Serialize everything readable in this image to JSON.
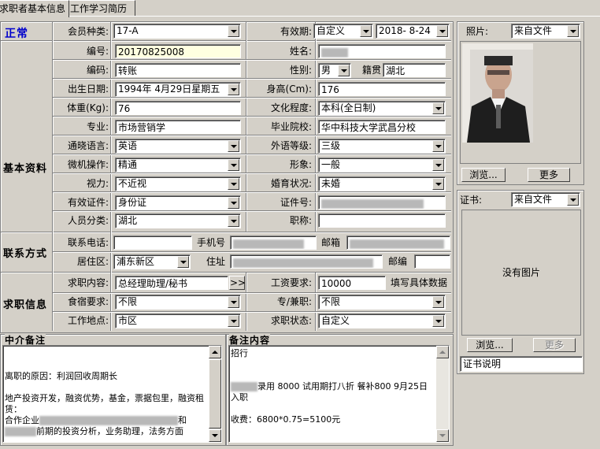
{
  "tabs": [
    "求职者基本信息",
    "工作学习简历"
  ],
  "status": "正常",
  "sections": {
    "basic": "基本资料",
    "contact": "联系方式",
    "jobinfo": "求职信息",
    "agency_note": "中介备注",
    "note": "备注内容"
  },
  "row1": {
    "member_type_label": "会员种类:",
    "member_type": "17-A",
    "validity_label": "有效期:",
    "validity_mode": "自定义",
    "validity_date": "2018- 8-24"
  },
  "fields": {
    "id_label": "编号:",
    "id": "20170825008",
    "code_label": "编码:",
    "code": "转账",
    "birth_label": "出生日期:",
    "birth": "1994年 4月29日星期五",
    "weight_label": "体重(Kg):",
    "weight": "76",
    "major_label": "专业:",
    "major": "市场营销学",
    "lang_label": "通晓语言:",
    "lang": "英语",
    "pc_label": "微机操作:",
    "pc": "精通",
    "vision_label": "视力:",
    "vision": "不近视",
    "cert_label": "有效证件:",
    "cert": "身份证",
    "category_label": "人员分类:",
    "category": "湖北",
    "name_label": "姓名:",
    "gender_label": "性别:",
    "gender": "男",
    "native_label": "籍贯",
    "native": "湖北",
    "height_label": "身高(Cm):",
    "height": "176",
    "edu_label": "文化程度:",
    "edu": "本科(全日制)",
    "school_label": "毕业院校:",
    "school": "华中科技大学武昌分校",
    "langlevel_label": "外语等级:",
    "langlevel": "三级",
    "image_label": "形象:",
    "image": "一般",
    "marital_label": "婚育状况:",
    "marital": "未婚",
    "certno_label": "证件号:",
    "title_label": "职称:",
    "title": ""
  },
  "contact": {
    "phone_label": "联系电话:",
    "mobile_label": "手机号",
    "email_label": "邮箱",
    "district_label": "居住区:",
    "district": "浦东新区",
    "address_label": "住址",
    "zip_label": "邮编"
  },
  "job": {
    "position_label": "求职内容:",
    "position": "总经理助理/秘书",
    "more": ">>",
    "salary_label": "工资要求:",
    "salary": "10000",
    "salary_hint": "填写具体数据",
    "board_label": "食宿要求:",
    "board": "不限",
    "fulltime_label": "专/兼职:",
    "fulltime": "不限",
    "location_label": "工作地点:",
    "location": "市区",
    "state_label": "求职状态:",
    "state": "自定义"
  },
  "photo": {
    "label": "照片:",
    "source": "来自文件",
    "browse": "浏览...",
    "more": "更多"
  },
  "certificate": {
    "label": "证书:",
    "source": "来自文件",
    "empty": "没有图片",
    "browse": "浏览...",
    "more": "更多",
    "desc": "证书说明"
  },
  "agency_lines": [
    "",
    "",
    "离职的原因：利润回收周期长",
    "",
    "地产投资开发，融资优势，基金，票据包里，融资租赁：",
    "合作企业",
    "前期的投资分析，业务助理，法务方面"
  ],
  "agency_partner_suffix": "和",
  "note_lines": {
    "l1": "招行",
    "l2": "录用 8000 试用期打八折 餐补800 9月25日入职",
    "l3": "收费：6800*0.75=5100元"
  }
}
